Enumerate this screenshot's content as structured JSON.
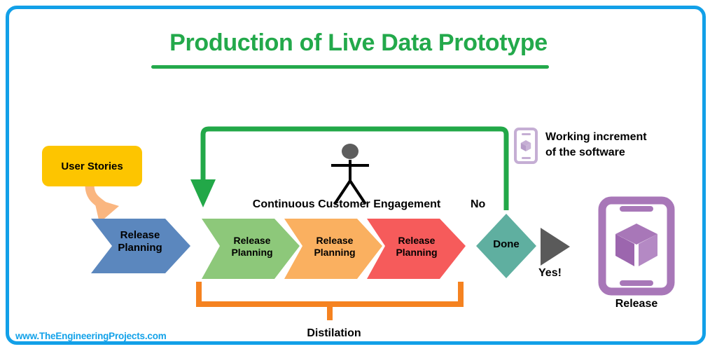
{
  "page": {
    "title": "Production of Live Data Prototype",
    "watermark": "www.TheEngineeringProjects.com",
    "frame_color": "#12A0E8",
    "title_color": "#23A94B"
  },
  "diagram": {
    "input_box": {
      "label": "User Stories",
      "color": "#FDC500",
      "icon": "rounded-box"
    },
    "input_arrow": {
      "icon": "curved-down-arrow",
      "color": "#FAB680"
    },
    "initial_stage": {
      "label": "Release\nPlanning",
      "color": "#5B87BE",
      "shape": "chevron"
    },
    "iteration_stages": [
      {
        "label": "Release\nPlanning",
        "color": "#8DC87A"
      },
      {
        "label": "Release\nPlanning",
        "color": "#FAB060"
      },
      {
        "label": "Release\nPlanning",
        "color": "#F65B5B"
      }
    ],
    "engagement": {
      "label": "Continuous Customer Engagement",
      "icon": "stick-figure-person",
      "head_color": "#5D5D5D",
      "body_color": "#000000"
    },
    "decision": {
      "label": "Done",
      "color": "#5FAFA0",
      "shape": "diamond",
      "no_label": "No",
      "yes_label": "Yes!"
    },
    "feedback_loop": {
      "icon": "loop-back-arrow",
      "color": "#22A848",
      "branch_label": "No"
    },
    "yes_arrow": {
      "icon": "triangle-right-arrow",
      "color": "#5A5A5A"
    },
    "increment_note": {
      "label": "Working increment\nof the software",
      "icon": "phone-cube-icon",
      "color": "#C5AED4"
    },
    "release_output": {
      "label": "Release",
      "icon": "phone-cube-icon",
      "color": "#A877B8"
    },
    "distilation": {
      "label": "Distilation",
      "icon": "bracket-underline",
      "color": "#F58220"
    }
  }
}
